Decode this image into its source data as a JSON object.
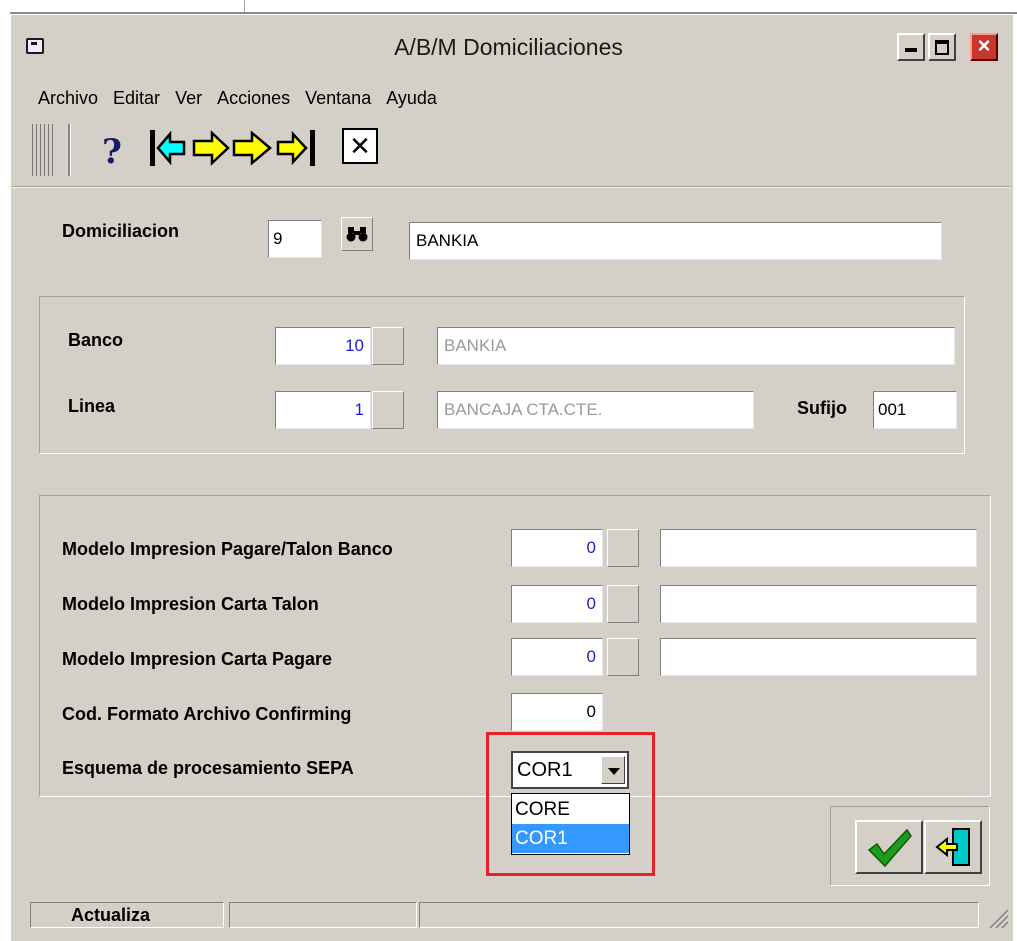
{
  "window": {
    "title": "A/B/M Domiciliaciones",
    "buttons": {
      "minimize": "minimize",
      "maximize": "maximize",
      "close": "×"
    }
  },
  "menu": [
    "Archivo",
    "Editar",
    "Ver",
    "Acciones",
    "Ventana",
    "Ayuda"
  ],
  "toolbar": {
    "help": "?",
    "first": "⇤",
    "prev": "⇦",
    "next": "⇨",
    "last": "⇥",
    "delete": "✕"
  },
  "domiciliacion": {
    "label": "Domiciliacion",
    "code": "9",
    "name": "BANKIA"
  },
  "banco": {
    "label": "Banco",
    "code": "10",
    "name": "BANKIA"
  },
  "linea": {
    "label": "Linea",
    "code": "1",
    "name": "BANCAJA CTA.CTE.",
    "sufijo_label": "Sufijo",
    "sufijo": "001"
  },
  "modelos": [
    {
      "label": "Modelo Impresion Pagare/Talon Banco",
      "value": "0",
      "desc": ""
    },
    {
      "label": "Modelo Impresion Carta Talon",
      "value": "0",
      "desc": ""
    },
    {
      "label": "Modelo Impresion Carta Pagare",
      "value": "0",
      "desc": ""
    }
  ],
  "confirming": {
    "label": "Cod. Formato Archivo Confirming",
    "value": "0"
  },
  "sepa": {
    "label": "Esquema de procesamiento SEPA",
    "selected": "COR1",
    "options": [
      "CORE",
      "COR1"
    ]
  },
  "status": {
    "pane1": "Actualiza",
    "pane2": "",
    "pane3": ""
  },
  "colors": {
    "window_bg": "#d4d0c8",
    "number_text": "#1e1ecd",
    "highlight": "#3399ff",
    "annotation": "#e8202a"
  }
}
